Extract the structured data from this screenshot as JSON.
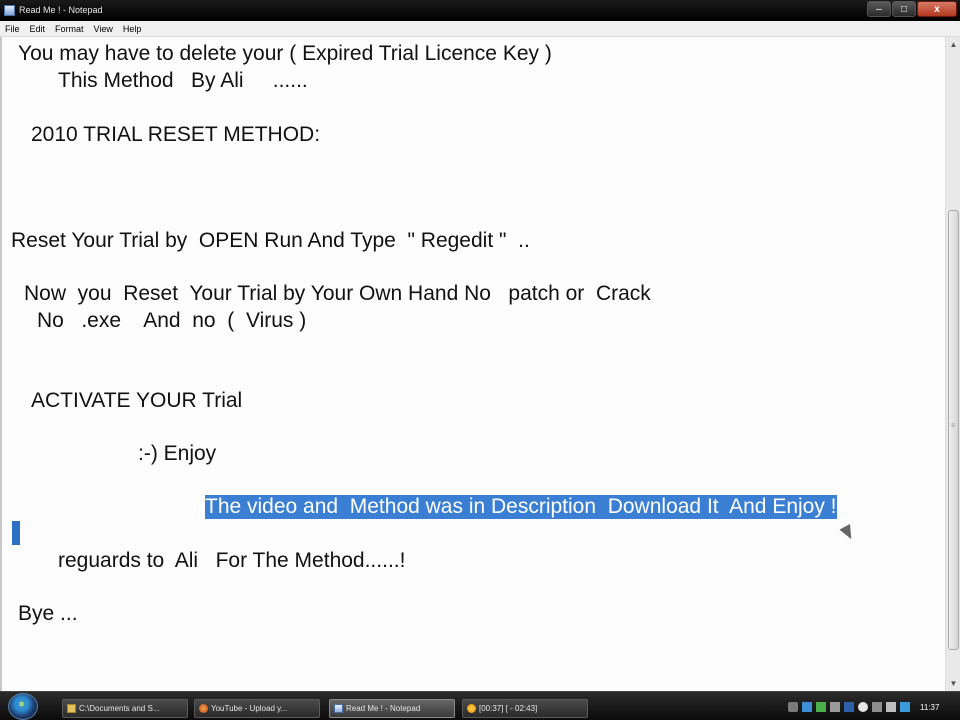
{
  "window": {
    "title": "Read Me ! - Notepad",
    "buttons": {
      "minimize": "–",
      "maximize": "□",
      "close": "x"
    }
  },
  "menu": {
    "items": [
      "File",
      "Edit",
      "Format",
      "View",
      "Help"
    ]
  },
  "document": {
    "lines": [
      "You may have to delete your ( Expired Trial Licence Key )",
      "This Method   By Ali     ......",
      "2010 TRIAL RESET METHOD:",
      "Reset Your Trial by  OPEN Run And Type  \" Regedit \"  ..",
      "Now  you  Reset  Your Trial by Your Own Hand No   patch or  Crack",
      "No   .exe    And  no  (  Virus )",
      "ACTIVATE YOUR Trial",
      ":-) Enjoy",
      "The video and  Method was in Description  Download It  And Enjoy !",
      "reguards to  Ali   For The Method......!",
      "Bye ..."
    ]
  },
  "scrollbar": {
    "up_arrow": "▲",
    "down_arrow": "▼",
    "grip": "≡"
  },
  "taskbar": {
    "items": [
      {
        "label": "C:\\Documents and S...",
        "icon": "folder-icon"
      },
      {
        "label": "YouTube - Upload y...",
        "icon": "firefox-icon"
      },
      {
        "label": "Read Me ! - Notepad",
        "icon": "notepad-icon"
      },
      {
        "label": "[00:37] [ - 02:43]",
        "icon": "recorder-icon"
      }
    ],
    "clock": "11:37"
  }
}
